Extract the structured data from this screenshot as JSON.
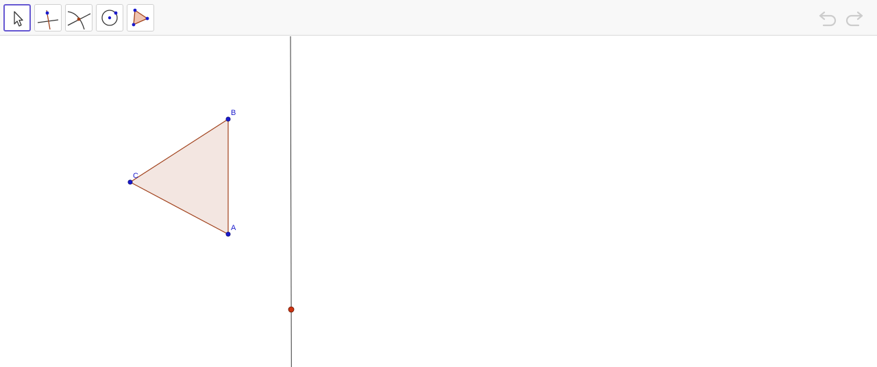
{
  "toolbar": {
    "tools": [
      {
        "id": "move",
        "icon": "move-arrow-icon",
        "active": true
      },
      {
        "id": "perpendicular-line",
        "icon": "perpendicular-line-icon",
        "active": false
      },
      {
        "id": "intersect",
        "icon": "intersect-icon",
        "active": false
      },
      {
        "id": "circle-center-point",
        "icon": "circle-center-point-icon",
        "active": false
      },
      {
        "id": "polygon",
        "icon": "polygon-icon",
        "active": false
      }
    ],
    "undo_icon": "undo-icon",
    "redo_icon": "redo-icon"
  },
  "colors": {
    "point_blue": "#1a1acc",
    "point_red": "#cc3311",
    "polygon_fill": "#f3e6e1",
    "polygon_stroke": "#a0401a",
    "line": "#333333",
    "active_tool_border": "#6557d2",
    "history_icon": "#cccccc"
  },
  "construction": {
    "points": [
      {
        "name": "B",
        "label": "B"
      },
      {
        "name": "C",
        "label": "C"
      },
      {
        "name": "A",
        "label": "A"
      }
    ]
  }
}
